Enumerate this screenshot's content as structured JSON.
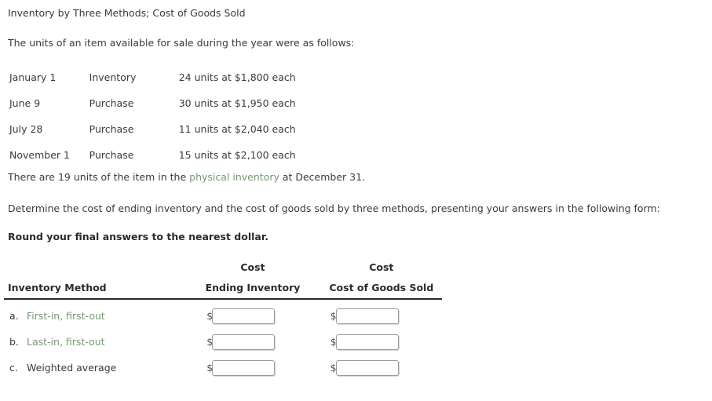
{
  "document": {
    "title": "Inventory by Three Methods; Cost of Goods Sold",
    "lead": "The units of an item available for sale during the year were as follows:",
    "physical_inventory_sentence": {
      "before": "There are 19 units of the item in the ",
      "link": "physical inventory",
      "after": " at December 31."
    },
    "determine": "Determine the cost of ending inventory and the cost of goods sold by three methods, presenting your answers in the following form:",
    "round_note": "Round your final answers to the nearest dollar."
  },
  "purchases": {
    "rows": [
      {
        "date": "January 1",
        "type": "Inventory",
        "units": "24 units at $1,800 each"
      },
      {
        "date": "June 9",
        "type": "Purchase",
        "units": "30 units at $1,950 each"
      },
      {
        "date": "July 28",
        "type": "Purchase",
        "units": "11 units at $2,040 each"
      },
      {
        "date": "November 1",
        "type": "Purchase",
        "units": "15 units at $2,100 each"
      }
    ]
  },
  "answer_table": {
    "headers": {
      "method": "Inventory Method",
      "ending_inventory_top": "Cost",
      "ending_inventory_bottom": "Ending Inventory",
      "cogs_top": "Cost",
      "cogs_bottom": "Cost of Goods Sold"
    },
    "currency_symbol": "$",
    "rows": [
      {
        "letter": "a.",
        "method": "First-in, first-out",
        "is_link": true,
        "ending_inventory": "",
        "cogs": ""
      },
      {
        "letter": "b.",
        "method": "Last-in, first-out",
        "is_link": true,
        "ending_inventory": "",
        "cogs": ""
      },
      {
        "letter": "c.",
        "method": "Weighted average",
        "is_link": false,
        "ending_inventory": "",
        "cogs": ""
      }
    ]
  },
  "colors": {
    "glossary_link": "#6d9e6d",
    "body_text": "#3a3a3a",
    "heading_text": "#2b2b2b",
    "input_border": "#9a9a9a",
    "background": "#ffffff"
  }
}
